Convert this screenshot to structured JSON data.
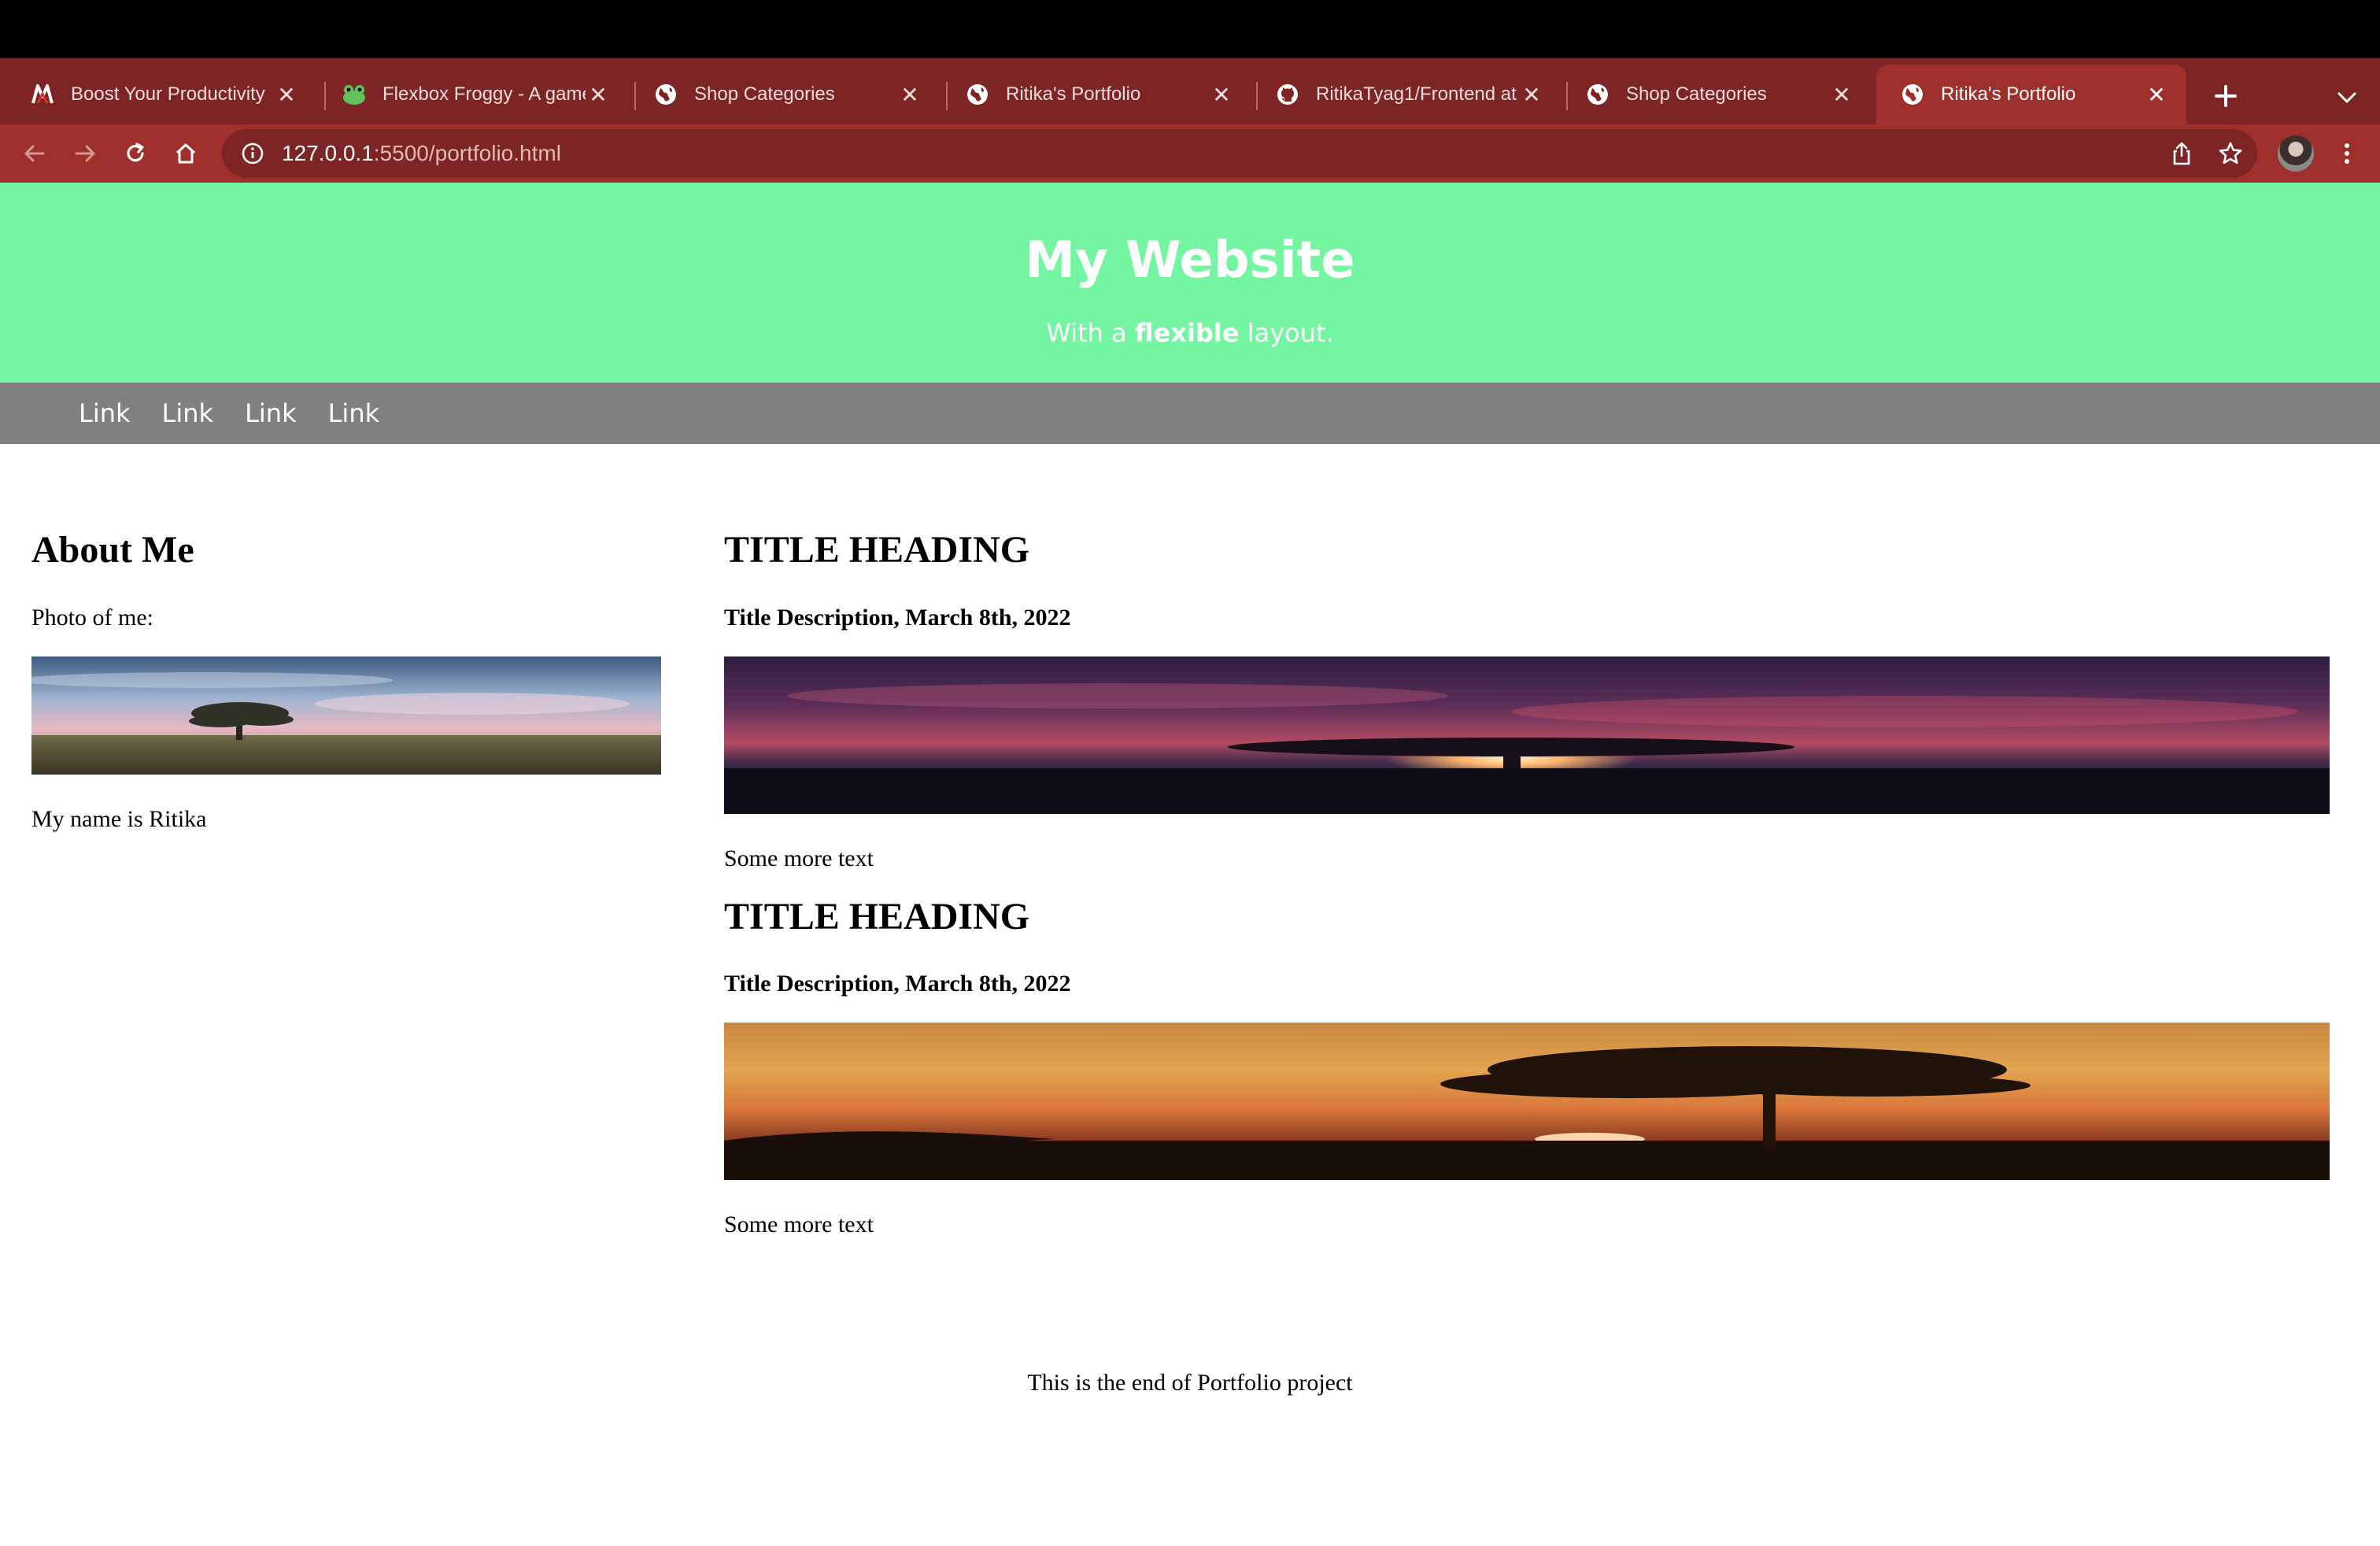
{
  "browser": {
    "tabs": [
      {
        "label": "Boost Your Productivity",
        "icon": "m-logo-icon",
        "active": false
      },
      {
        "label": "Flexbox Froggy - A game",
        "icon": "frog-icon",
        "active": false
      },
      {
        "label": "Shop Categories",
        "icon": "globe-icon",
        "active": false
      },
      {
        "label": "Ritika's Portfolio",
        "icon": "globe-icon",
        "active": false
      },
      {
        "label": "RitikaTyag1/Frontend at",
        "icon": "github-icon",
        "active": false
      },
      {
        "label": "Shop Categories",
        "icon": "globe-icon",
        "active": false
      },
      {
        "label": "Ritika's Portfolio",
        "icon": "globe-icon",
        "active": true
      }
    ],
    "url_host": "127.0.0.1",
    "url_path": ":5500/portfolio.html",
    "colors": {
      "tab_strip": "#7c2524",
      "toolbar": "#9e2f2a"
    }
  },
  "header": {
    "title": "My Website",
    "subtitle_before": "With a ",
    "subtitle_bold": "flexible",
    "subtitle_after": " layout."
  },
  "nav": {
    "links": [
      "Link",
      "Link",
      "Link",
      "Link"
    ]
  },
  "side": {
    "heading": "About Me",
    "photo_label": "Photo of me:",
    "bio": "My name is Ritika"
  },
  "main": {
    "posts": [
      {
        "heading": "TITLE HEADING",
        "description": "Title Description, March 8th, 2022",
        "text": "Some more text"
      },
      {
        "heading": "TITLE HEADING",
        "description": "Title Description, March 8th, 2022",
        "text": "Some more text"
      }
    ]
  },
  "footer": {
    "text": "This is the end of Portfolio project"
  },
  "colors": {
    "header_bg": "#74f5a1",
    "nav_bg": "#808080"
  }
}
